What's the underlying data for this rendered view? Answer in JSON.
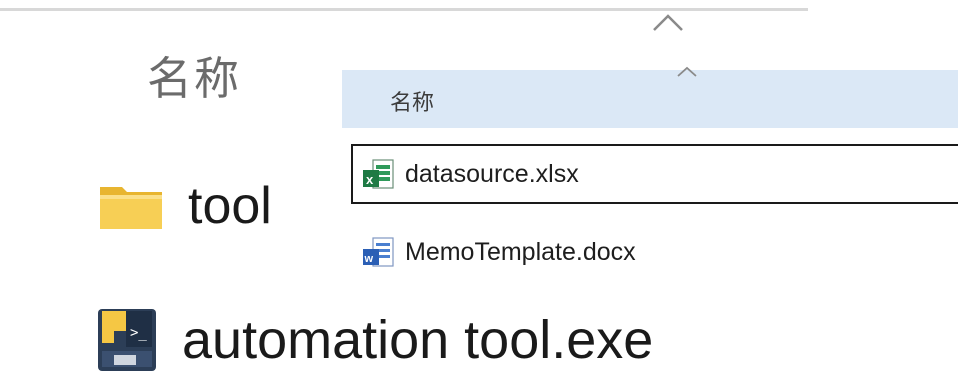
{
  "back_panel": {
    "column_header": "名称",
    "items": [
      {
        "name": "tool",
        "icon": "folder-icon"
      },
      {
        "name": "automation tool.exe",
        "icon": "python-exe-icon"
      }
    ]
  },
  "front_panel": {
    "column_header": "名称",
    "items": [
      {
        "name": "datasource.xlsx",
        "icon": "excel-file-icon",
        "selected": true
      },
      {
        "name": "MemoTemplate.docx",
        "icon": "word-file-icon",
        "selected": false
      }
    ]
  },
  "colors": {
    "header_bg": "#dbe8f6",
    "folder": "#f5c744",
    "excel": "#1e7a44",
    "word": "#2b5fb5"
  }
}
